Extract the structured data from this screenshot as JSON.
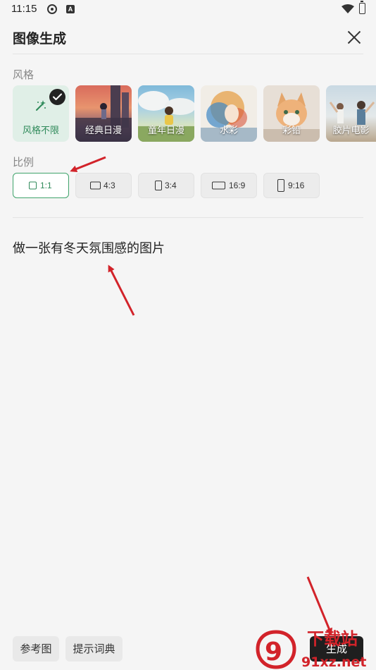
{
  "status_bar": {
    "time": "11:15",
    "badge_letter": "A"
  },
  "header": {
    "title": "图像生成",
    "close_icon": "close-icon"
  },
  "style_section": {
    "label": "风格",
    "items": [
      {
        "label": "风格不限",
        "selected": true
      },
      {
        "label": "经典日漫",
        "selected": false
      },
      {
        "label": "童年日漫",
        "selected": false
      },
      {
        "label": "水彩",
        "selected": false
      },
      {
        "label": "彩铅",
        "selected": false
      },
      {
        "label": "胶片电影",
        "selected": false
      }
    ]
  },
  "ratio_section": {
    "label": "比例",
    "items": [
      {
        "label": "1:1",
        "selected": true
      },
      {
        "label": "4:3",
        "selected": false
      },
      {
        "label": "3:4",
        "selected": false
      },
      {
        "label": "16:9",
        "selected": false
      },
      {
        "label": "9:16",
        "selected": false
      }
    ]
  },
  "prompt": {
    "value": "做一张有冬天氛围感的图片"
  },
  "bottom_bar": {
    "reference_label": "参考图",
    "dictionary_label": "提示词典",
    "generate_label": "生成"
  },
  "watermark": {
    "logo_text": "9",
    "url": "91xz.net",
    "top_text": "下载站"
  },
  "colors": {
    "accent": "#2f8a5a",
    "arrow": "#d2232a",
    "generate_bg": "#1f1f1f"
  }
}
